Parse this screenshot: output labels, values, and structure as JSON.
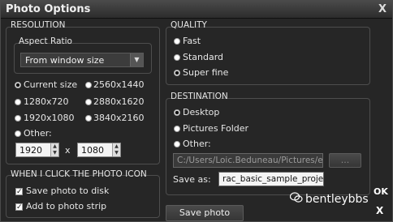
{
  "window": {
    "title": "Photo Options",
    "close_glyph": "X"
  },
  "resolution": {
    "heading": "RESOLUTION",
    "aspect_ratio_label": "Aspect Ratio",
    "aspect_ratio_value": "From window size",
    "options": [
      "Current size",
      "2560x1440",
      "1280x720",
      "2880x1620",
      "1920x1080",
      "3840x2160",
      "Other:"
    ],
    "selected": "Current size",
    "width_value": "1920",
    "height_value": "1080",
    "times": "x"
  },
  "photo_icon": {
    "heading": "WHEN I CLICK THE PHOTO ICON",
    "save_to_disk": "Save photo to disk",
    "add_to_strip": "Add to photo strip",
    "save_to_disk_checked": true,
    "add_to_strip_checked": true
  },
  "quality": {
    "heading": "QUALITY",
    "options": [
      "Fast",
      "Standard",
      "Super fine"
    ],
    "selected": "Super fine"
  },
  "destination": {
    "heading": "DESTINATION",
    "options": [
      "Desktop",
      "Pictures Folder",
      "Other:"
    ],
    "selected": "Desktop",
    "path_value": "C:/Users/Loic.Beduneau/Pictures/e-o",
    "browse_label": "...",
    "save_as_label": "Save as:",
    "save_as_value": "rac_basic_sample_project"
  },
  "actions": {
    "save_photo": "Save photo",
    "ok": "OK",
    "close": "X"
  },
  "watermark": {
    "text": "bentleybbs",
    "icon": "wechat-icon"
  },
  "colors": {
    "window_bg": "#262626",
    "titlebar": "#3a3a3a",
    "border": "#4d4d4d"
  }
}
